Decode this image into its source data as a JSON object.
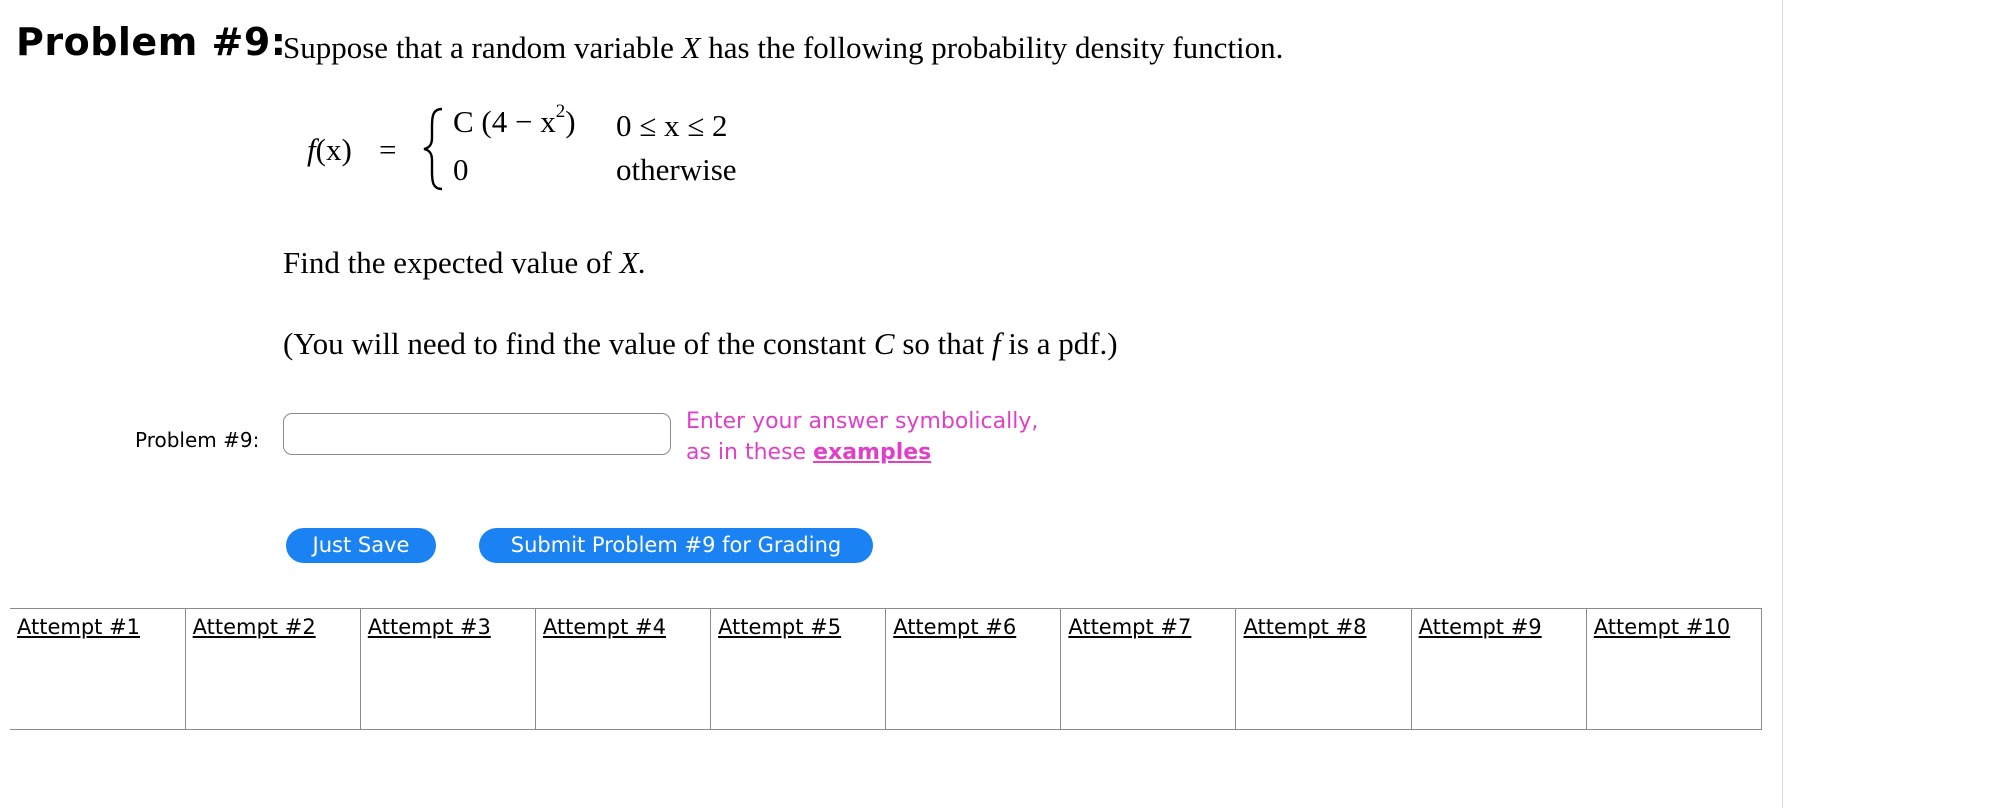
{
  "problem": {
    "heading": "Problem #9:",
    "intro_prefix": "Suppose that a random variable",
    "intro_var": "X",
    "intro_suffix": "has the following probability density function.",
    "formula": {
      "lhs_fn": "f",
      "lhs_arg": "(x)",
      "equals": "=",
      "case1_expr_pre": "C (4 − x",
      "case1_expr_exp": "2",
      "case1_expr_post": ")",
      "case1_condition": "0 ≤ x ≤ 2",
      "case2_expr": "0",
      "case2_condition": "otherwise"
    },
    "question_prefix": "Find the expected value of",
    "question_var": "X.",
    "note_prefix": "(You will need to find the value of the constant",
    "note_const": "C",
    "note_mid": "so that",
    "note_fn": "f",
    "note_suffix": "is a pdf.)"
  },
  "answer": {
    "label": "Problem #9:",
    "value": "",
    "placeholder": "",
    "hint_line1": "Enter your answer symbolically,",
    "hint_line2_prefix": "as in these",
    "hint_link": "examples"
  },
  "buttons": {
    "save": "Just Save",
    "submit": "Submit Problem #9 for Grading"
  },
  "attempts": [
    "Attempt #1",
    "Attempt #2",
    "Attempt #3",
    "Attempt #4",
    "Attempt #5",
    "Attempt #6",
    "Attempt #7",
    "Attempt #8",
    "Attempt #9",
    "Attempt #10"
  ],
  "colors": {
    "button_bg": "#1a82f3",
    "hint_text": "#e040c8",
    "divider": "#d9d9d9"
  }
}
